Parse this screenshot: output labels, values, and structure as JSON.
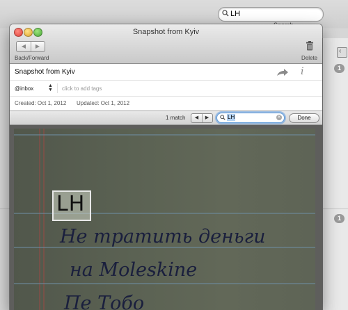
{
  "background": {
    "search": {
      "value": "LH",
      "label": "Search"
    },
    "counts": [
      "1",
      "1"
    ]
  },
  "window": {
    "title": "Snapshot from Kyiv",
    "toolbar": {
      "back_forward_label": "Back/Forward",
      "back_glyph": "◀",
      "forward_glyph": "▶",
      "delete_label": "Delete"
    },
    "note": {
      "title": "Snapshot from Kyiv",
      "notebook": "@inbox",
      "tags_placeholder": "click to add tags",
      "created": "Created: Oct 1, 2012",
      "updated": "Updated: Oct 1, 2012"
    },
    "findbar": {
      "match_text": "1 match",
      "prev_glyph": "◀",
      "next_glyph": "▶",
      "query": "LH",
      "done_label": "Done"
    },
    "image": {
      "highlight_text": "LH",
      "handwriting": [
        "Не тратить деньги",
        "на Moleskine",
        "Пе  Тобо"
      ]
    }
  },
  "colors": {
    "accent": "#5e9ad8",
    "selection": "#b5d3f3",
    "badge": "#9a9a9a"
  },
  "icons": [
    "search-icon",
    "trash-icon",
    "share-icon",
    "info-icon",
    "clear-icon"
  ]
}
